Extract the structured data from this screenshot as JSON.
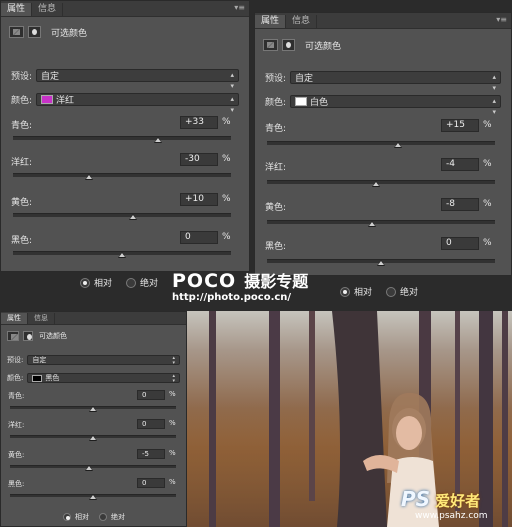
{
  "panels": [
    {
      "tabs": [
        "属性",
        "信息"
      ],
      "title": "可选颜色",
      "preset_label": "预设:",
      "preset_value": "自定",
      "color_label": "颜色:",
      "color_value": "洋红",
      "color_swatch": "#c832c8",
      "sliders": [
        {
          "name": "青色:",
          "value": "+33",
          "unit": "%",
          "level": 0.665
        },
        {
          "name": "洋红:",
          "value": "-30",
          "unit": "%",
          "level": 0.35
        },
        {
          "name": "黄色:",
          "value": "+10",
          "unit": "%",
          "level": 0.55
        },
        {
          "name": "黑色:",
          "value": "0",
          "unit": "%",
          "level": 0.5
        }
      ],
      "mode_relative": "相对",
      "mode_absolute": "绝对",
      "selected_mode": "relative"
    },
    {
      "tabs": [
        "属性",
        "信息"
      ],
      "title": "可选颜色",
      "preset_label": "预设:",
      "preset_value": "自定",
      "color_label": "颜色:",
      "color_value": "白色",
      "color_swatch": "#ffffff",
      "sliders": [
        {
          "name": "青色:",
          "value": "+15",
          "unit": "%",
          "level": 0.575
        },
        {
          "name": "洋红:",
          "value": "-4",
          "unit": "%",
          "level": 0.48
        },
        {
          "name": "黄色:",
          "value": "-8",
          "unit": "%",
          "level": 0.46
        },
        {
          "name": "黑色:",
          "value": "0",
          "unit": "%",
          "level": 0.5
        }
      ],
      "mode_relative": "相对",
      "mode_absolute": "绝对",
      "selected_mode": "relative"
    },
    {
      "tabs": [
        "属性",
        "信息"
      ],
      "title": "可选颜色",
      "preset_label": "预设:",
      "preset_value": "自定",
      "color_label": "颜色:",
      "color_value": "黑色",
      "color_swatch": "#000000",
      "sliders": [
        {
          "name": "青色:",
          "value": "0",
          "unit": "%",
          "level": 0.5
        },
        {
          "name": "洋红:",
          "value": "0",
          "unit": "%",
          "level": 0.5
        },
        {
          "name": "黄色:",
          "value": "-5",
          "unit": "%",
          "level": 0.475
        },
        {
          "name": "黑色:",
          "value": "0",
          "unit": "%",
          "level": 0.5
        }
      ],
      "mode_relative": "相对",
      "mode_absolute": "绝对",
      "selected_mode": "relative"
    }
  ],
  "watermark_poco": {
    "brand": "POCO",
    "slogan": "摄影专题",
    "url": "http://photo.poco.cn/"
  },
  "watermark_ps": {
    "logo": "PS",
    "name": "爱好者",
    "url": "www.psahz.com"
  },
  "colors": {
    "panel_bg": "#525252",
    "tab_bg": "#3c3c3c",
    "field_bg": "#3a3a3a"
  }
}
